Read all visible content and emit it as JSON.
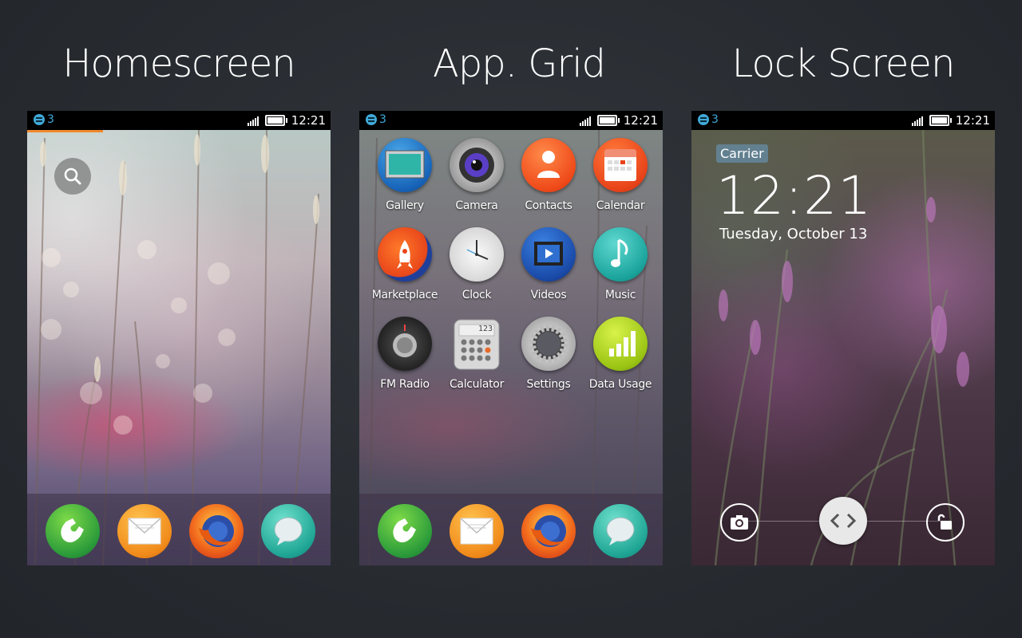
{
  "headings": {
    "homescreen": "Homescreen",
    "app_grid": "App. Grid",
    "lock_screen": "Lock Screen"
  },
  "status_bar": {
    "notification_count": "3",
    "time": "12:21",
    "notification_color": "#3fa9d8"
  },
  "homescreen": {
    "search_icon": "search-icon",
    "dock": [
      {
        "name": "phone-icon"
      },
      {
        "name": "mail-icon"
      },
      {
        "name": "firefox-icon"
      },
      {
        "name": "messages-icon"
      }
    ]
  },
  "app_grid": {
    "apps": [
      {
        "label": "Gallery",
        "icon": "gallery-icon"
      },
      {
        "label": "Camera",
        "icon": "camera-icon"
      },
      {
        "label": "Contacts",
        "icon": "contacts-icon"
      },
      {
        "label": "Calendar",
        "icon": "calendar-icon"
      },
      {
        "label": "Marketplace",
        "icon": "marketplace-icon"
      },
      {
        "label": "Clock",
        "icon": "clock-icon"
      },
      {
        "label": "Videos",
        "icon": "videos-icon"
      },
      {
        "label": "Music",
        "icon": "music-icon"
      },
      {
        "label": "FM Radio",
        "icon": "fm-radio-icon"
      },
      {
        "label": "Calculator",
        "icon": "calculator-icon"
      },
      {
        "label": "Settings",
        "icon": "settings-icon"
      },
      {
        "label": "Data Usage",
        "icon": "data-usage-icon"
      }
    ],
    "calculator_display": "123"
  },
  "lock_screen": {
    "carrier": "Carrier",
    "time": "12:21",
    "date": "Tuesday, October 13"
  }
}
